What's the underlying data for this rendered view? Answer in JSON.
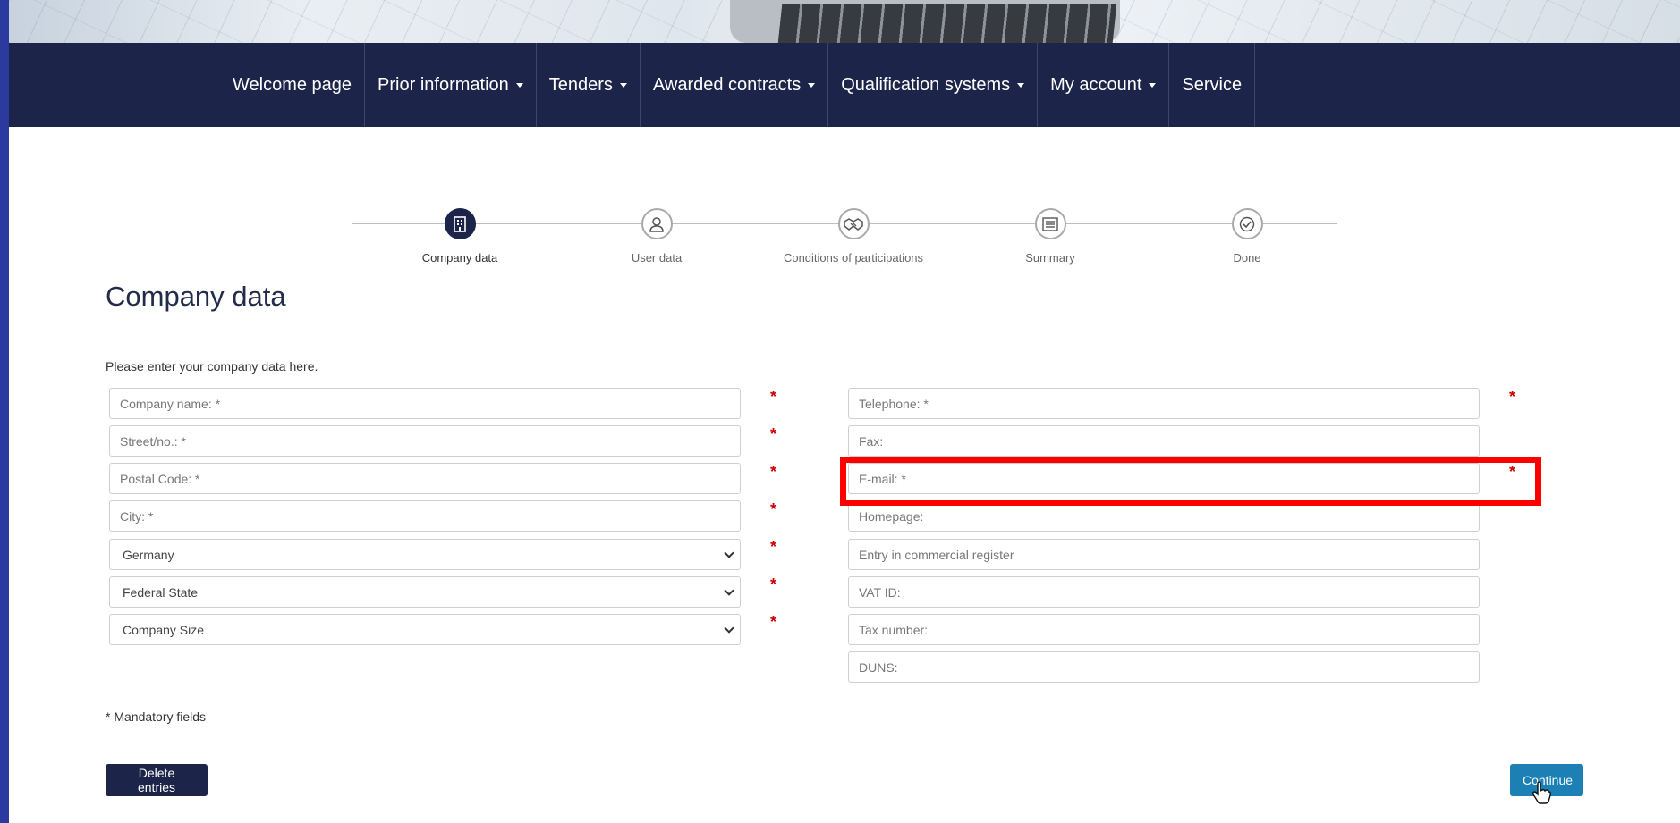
{
  "nav": {
    "items": [
      {
        "label": "Welcome page",
        "dropdown": false
      },
      {
        "label": "Prior information",
        "dropdown": true
      },
      {
        "label": "Tenders",
        "dropdown": true
      },
      {
        "label": "Awarded contracts",
        "dropdown": true
      },
      {
        "label": "Qualification systems",
        "dropdown": true
      },
      {
        "label": "My account",
        "dropdown": true
      },
      {
        "label": "Service",
        "dropdown": false
      }
    ]
  },
  "stepper": {
    "steps": [
      {
        "label": "Company data",
        "icon": "building-icon",
        "active": true
      },
      {
        "label": "User data",
        "icon": "user-icon",
        "active": false
      },
      {
        "label": "Conditions of participations",
        "icon": "handshake-icon",
        "active": false
      },
      {
        "label": "Summary",
        "icon": "list-icon",
        "active": false
      },
      {
        "label": "Done",
        "icon": "check-circle-icon",
        "active": false
      }
    ]
  },
  "form": {
    "title": "Company data",
    "intro": "Please enter your company data here.",
    "left": {
      "company_name": {
        "placeholder": "Company name: *",
        "value": ""
      },
      "street": {
        "placeholder": "Street/no.: *",
        "value": ""
      },
      "postal_code": {
        "placeholder": "Postal Code: *",
        "value": ""
      },
      "city": {
        "placeholder": "City: *",
        "value": ""
      },
      "country": {
        "selected": "Germany"
      },
      "federal_state": {
        "selected": "Federal State"
      },
      "company_size": {
        "selected": "Company Size"
      }
    },
    "right": {
      "telephone": {
        "placeholder": "Telephone: *",
        "value": ""
      },
      "fax": {
        "placeholder": "Fax:",
        "value": ""
      },
      "email": {
        "placeholder": "E-mail: *",
        "value": ""
      },
      "homepage": {
        "placeholder": "Homepage:",
        "value": ""
      },
      "commercial_register": {
        "placeholder": "Entry in commercial register",
        "value": ""
      },
      "vat_id": {
        "placeholder": "VAT ID:",
        "value": ""
      },
      "tax_number": {
        "placeholder": "Tax number:",
        "value": ""
      },
      "duns": {
        "placeholder": "DUNS:",
        "value": ""
      }
    },
    "required_mark": "*",
    "mandatory_note": "* Mandatory fields",
    "delete_label": "Delete entries",
    "continue_label": "Continue"
  },
  "colors": {
    "nav_bg": "#1c2549",
    "accent": "#1c80b4",
    "required": "#d00000",
    "highlight": "#ff0000"
  }
}
